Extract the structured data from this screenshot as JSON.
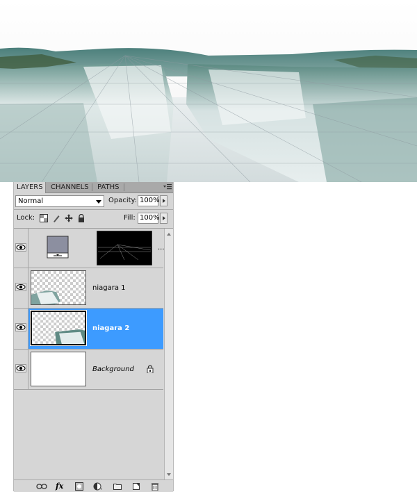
{
  "panel": {
    "tabs": [
      "LAYERS",
      "CHANNELS",
      "PATHS"
    ],
    "blend_mode": "Normal",
    "opacity_label": "Opacity:",
    "opacity_value": "100%",
    "lock_label": "Lock:",
    "fill_label": "Fill:",
    "fill_value": "100%"
  },
  "layers": [
    {
      "name": "",
      "visible": true,
      "type": "adjustment-with-mask",
      "more": "..."
    },
    {
      "name": "niagara 1",
      "visible": true,
      "type": "image"
    },
    {
      "name": "niagara 2",
      "visible": true,
      "type": "image",
      "selected": true
    },
    {
      "name": "Background",
      "visible": true,
      "type": "background",
      "locked": true
    }
  ],
  "bottom_icons": [
    "link-layers-icon",
    "fx-icon",
    "layer-mask-icon",
    "adjustment-layer-icon",
    "group-folder-icon",
    "new-layer-icon",
    "trash-icon"
  ],
  "icons": {
    "panel_menu": "panel-menu-icon",
    "lock_transparent": "lock-transparent-pixels-icon",
    "lock_image": "lock-image-pixels-icon",
    "lock_position": "lock-position-icon",
    "lock_all": "lock-all-icon",
    "eye": "eye-icon"
  },
  "colors": {
    "selection": "#3d9bff",
    "panel_bg": "#d6d6d6",
    "tab_bg": "#a9a9a9"
  },
  "fx_label": "fx"
}
